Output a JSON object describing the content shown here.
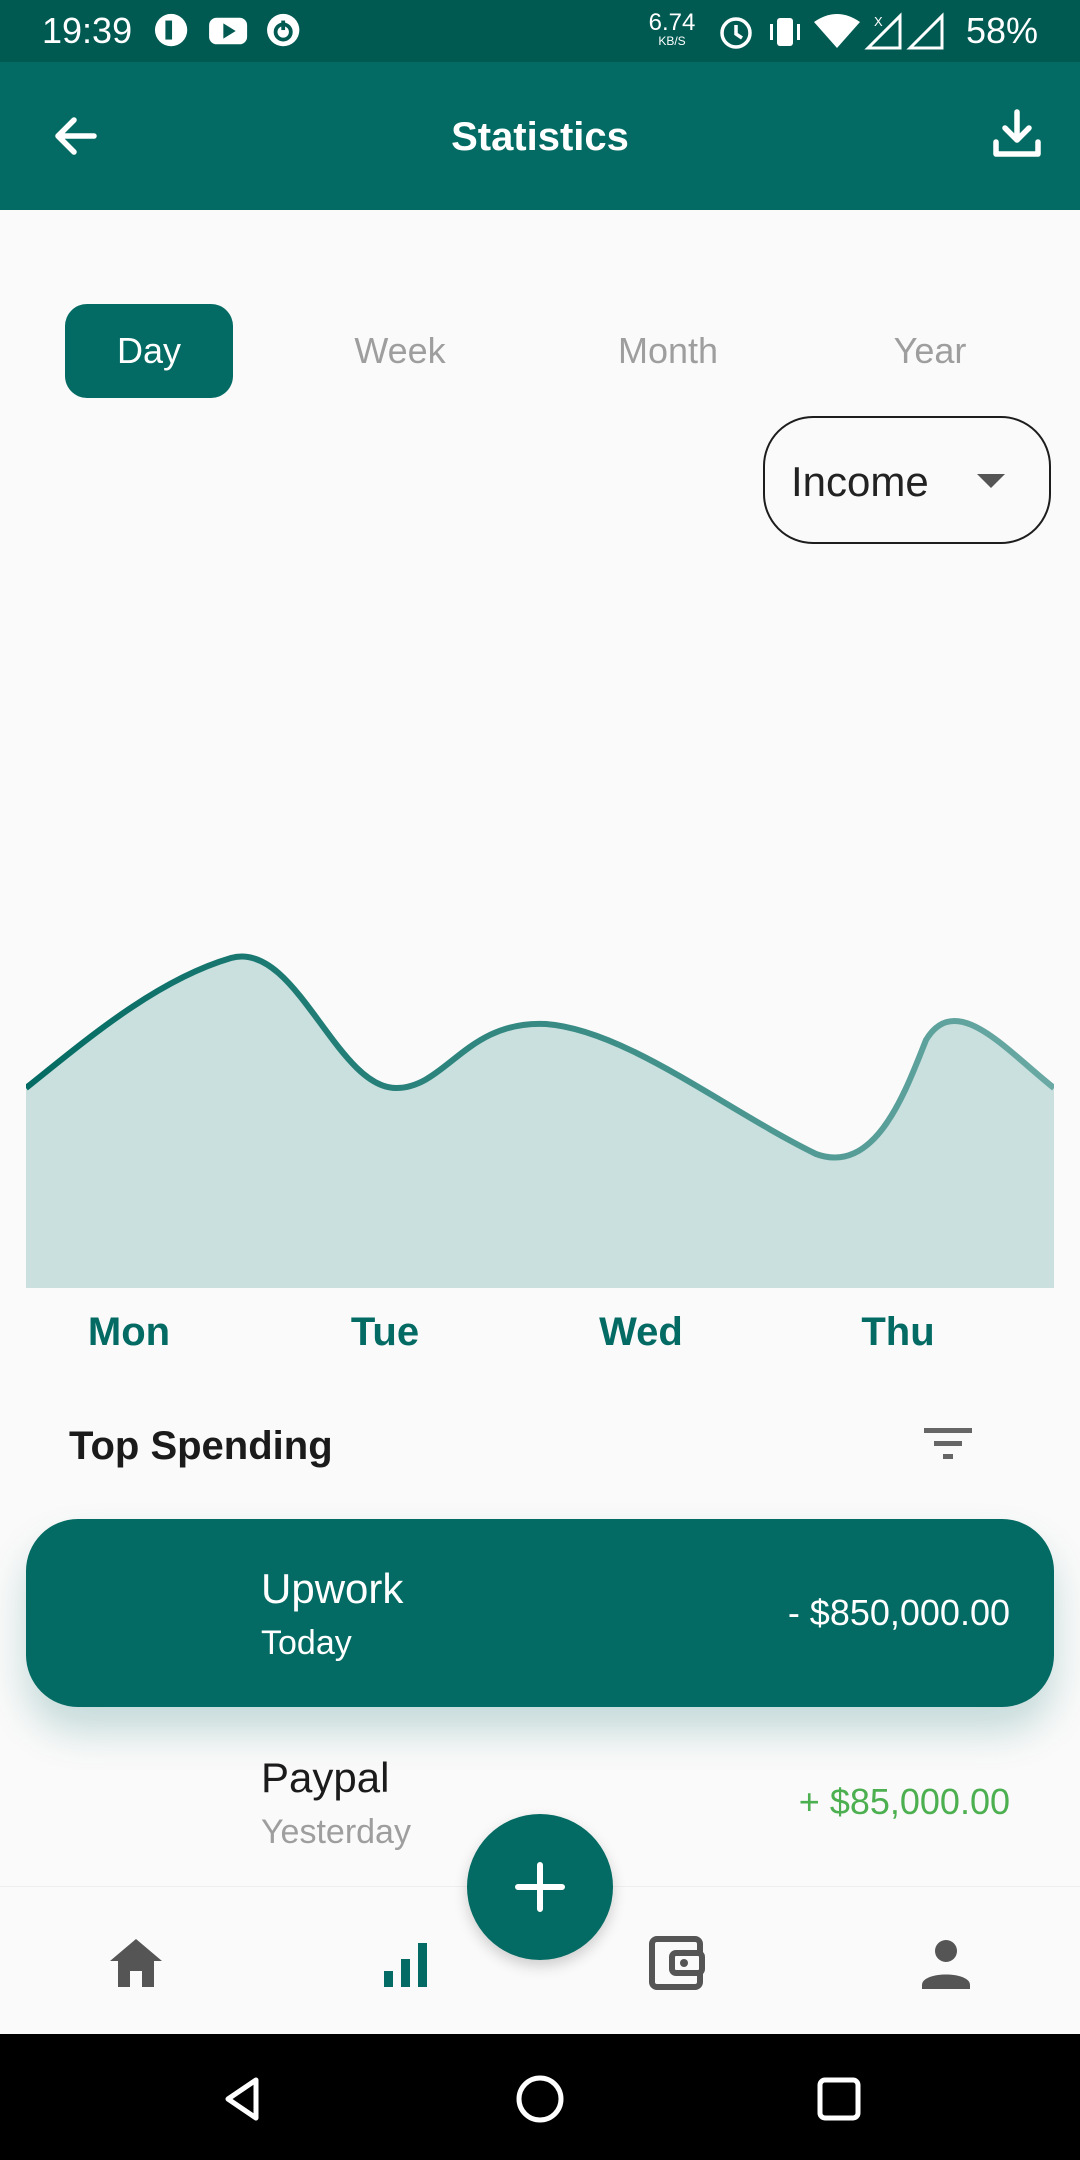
{
  "status_bar": {
    "time": "19:39",
    "speed_value": "6.74",
    "speed_unit": "KB/S",
    "battery": "58%",
    "icons": [
      "app-icon",
      "youtube-icon",
      "power-icon",
      "alarm-icon",
      "vibrate-icon",
      "wifi-icon",
      "signal-icon",
      "signal-icon"
    ]
  },
  "app_bar": {
    "title": "Statistics",
    "back_icon": "arrow-back-icon",
    "action_icon": "download-icon"
  },
  "tabs": [
    {
      "label": "Day",
      "active": true
    },
    {
      "label": "Week",
      "active": false
    },
    {
      "label": "Month",
      "active": false
    },
    {
      "label": "Year",
      "active": false
    }
  ],
  "dropdown": {
    "value": "Income"
  },
  "chart_data": {
    "type": "area",
    "categories": [
      "Mon",
      "Tue",
      "Wed",
      "Thu"
    ],
    "line_color": "#036B63",
    "fill_color": "#C9E0DE",
    "grid": false,
    "legend": "none"
  },
  "section": {
    "title": "Top Spending",
    "filter_icon": "filter-icon"
  },
  "transactions": [
    {
      "name": "Upwork",
      "date": "Today",
      "amount": "- $850,000.00",
      "highlight": true
    },
    {
      "name": "Paypal",
      "date": "Yesterday",
      "amount": "+ $85,000.00",
      "highlight": false
    }
  ],
  "bottom_nav": {
    "items": [
      "home-icon",
      "stats-icon",
      "wallet-icon",
      "profile-icon"
    ],
    "fab_icon": "add-icon"
  },
  "colors": {
    "primary": "#036B63",
    "status_bar": "#005A52",
    "income": "#4CAF50",
    "inactive": "#9E9E9E"
  }
}
